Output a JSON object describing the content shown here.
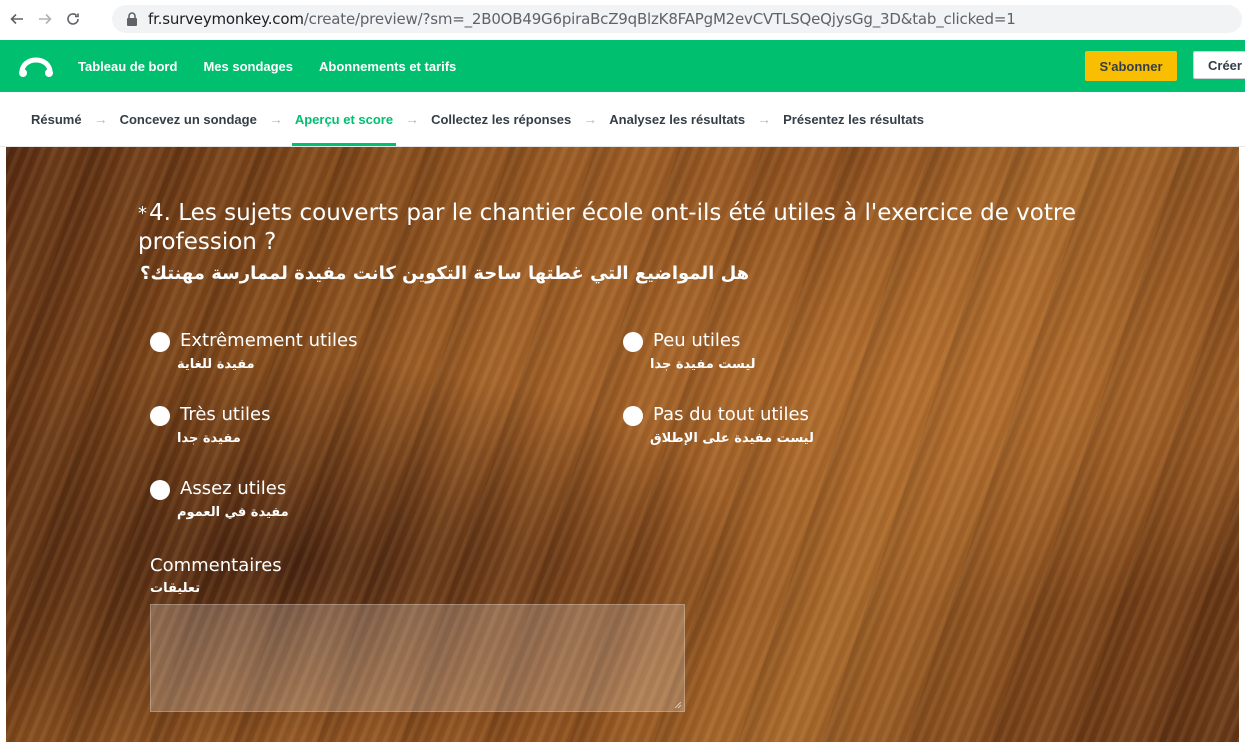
{
  "browser": {
    "url_domain": "fr.surveymonkey.com",
    "url_path": "/create/preview/?sm=_2B0OB49G6piraBcZ9qBlzK8FAPgM2evCVTLSQeQjysGg_3D&tab_clicked=1"
  },
  "topnav": {
    "items": [
      "Tableau de bord",
      "Mes sondages",
      "Abonnements et tarifs"
    ],
    "subscribe_label": "S'abonner",
    "create_label": "Créer"
  },
  "steps": {
    "items": [
      "Résumé",
      "Concevez un sondage",
      "Aperçu et score",
      "Collectez les réponses",
      "Analysez les résultats",
      "Présentez les résultats"
    ],
    "active": "Aperçu et score"
  },
  "question": {
    "star": "*",
    "title": "4. Les sujets couverts par le chantier école ont-ils été utiles à l'exercice de votre profession ?",
    "title_ar": "هل المواضيع التي غطتها ساحة التكوين كانت مفيدة لممارسة مهنتك؟",
    "options": [
      {
        "label": "Extrêmement utiles",
        "ar": "مفيدة للغاية"
      },
      {
        "label": "Très utiles",
        "ar": "مفيدة جدا"
      },
      {
        "label": "Assez utiles",
        "ar": "مفيدة في العموم"
      },
      {
        "label": "Peu utiles",
        "ar": "ليست مفيدة جدا"
      },
      {
        "label": "Pas du tout utiles",
        "ar": "ليست مفيدة على الإطلاق"
      }
    ],
    "comment_label": "Commentaires",
    "comment_label_ar": "تعليقات",
    "comment_value": ""
  },
  "colors": {
    "brand_green": "#00bf6f",
    "subscribe_yellow": "#f9be00"
  },
  "icons": [
    "back-arrow-icon",
    "forward-arrow-icon",
    "reload-icon",
    "lock-icon",
    "surveymonkey-logo-icon"
  ]
}
